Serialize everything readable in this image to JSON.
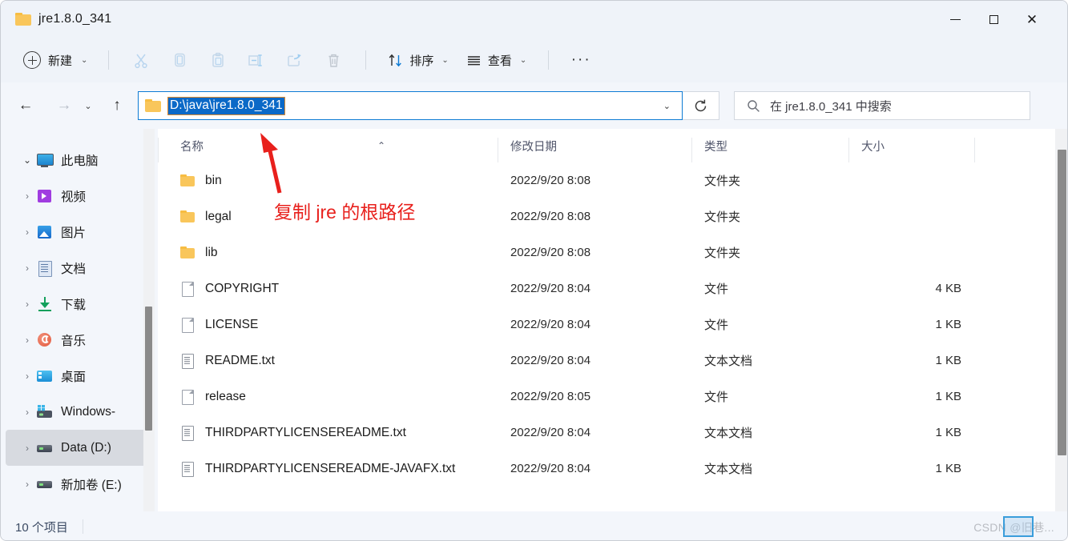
{
  "window": {
    "title": "jre1.8.0_341",
    "folder_icon": "folder-icon",
    "controls": {
      "minimize": "minimize-icon",
      "maximize": "maximize-icon",
      "close": "close-icon"
    }
  },
  "command_bar": {
    "new_label": "新建",
    "new_chevron": "⌄",
    "icons": [
      {
        "name": "cut-icon",
        "label": "剪切"
      },
      {
        "name": "copy-icon",
        "label": "复制"
      },
      {
        "name": "paste-icon",
        "label": "粘贴"
      },
      {
        "name": "rename-icon",
        "label": "重命名"
      },
      {
        "name": "share-icon",
        "label": "共享"
      },
      {
        "name": "delete-icon",
        "label": "删除"
      }
    ],
    "sort_label": "排序",
    "view_label": "查看",
    "overflow_label": "···"
  },
  "navigation": {
    "back": "←",
    "forward": "→",
    "recent_chevron": "⌄",
    "up": "↑",
    "address_path": "D:\\java\\jre1.8.0_341",
    "address_chevron": "⌄",
    "refresh_icon": "refresh-icon"
  },
  "search": {
    "icon": "search-icon",
    "placeholder": "在 jre1.8.0_341 中搜索"
  },
  "sidebar": {
    "items": [
      {
        "label": "此电脑",
        "icon": "this-pc-icon",
        "twisty": "⌄",
        "expanded": true,
        "selected": false
      },
      {
        "label": "视频",
        "icon": "videos-icon",
        "twisty": "›",
        "expanded": false,
        "selected": false
      },
      {
        "label": "图片",
        "icon": "pictures-icon",
        "twisty": "›",
        "expanded": false,
        "selected": false
      },
      {
        "label": "文档",
        "icon": "documents-icon",
        "twisty": "›",
        "expanded": false,
        "selected": false
      },
      {
        "label": "下载",
        "icon": "downloads-icon",
        "twisty": "›",
        "expanded": false,
        "selected": false
      },
      {
        "label": "音乐",
        "icon": "music-icon",
        "twisty": "›",
        "expanded": false,
        "selected": false
      },
      {
        "label": "桌面",
        "icon": "desktop-icon",
        "twisty": "›",
        "expanded": false,
        "selected": false
      },
      {
        "label": "Windows-",
        "icon": "windows-drive-icon",
        "twisty": "›",
        "expanded": false,
        "selected": false
      },
      {
        "label": "Data (D:)",
        "icon": "drive-icon",
        "twisty": "›",
        "expanded": false,
        "selected": true
      },
      {
        "label": "新加卷 (E:)",
        "icon": "drive-icon",
        "twisty": "›",
        "expanded": false,
        "selected": false
      }
    ]
  },
  "file_list": {
    "columns": [
      "名称",
      "修改日期",
      "类型",
      "大小"
    ],
    "sort_indicator": "⌃",
    "rows": [
      {
        "name": "bin",
        "icon": "folder-icon",
        "modified": "2022/9/20 8:08",
        "type": "文件夹",
        "size": ""
      },
      {
        "name": "legal",
        "icon": "folder-icon",
        "modified": "2022/9/20 8:08",
        "type": "文件夹",
        "size": ""
      },
      {
        "name": "lib",
        "icon": "folder-icon",
        "modified": "2022/9/20 8:08",
        "type": "文件夹",
        "size": ""
      },
      {
        "name": "COPYRIGHT",
        "icon": "file-icon",
        "modified": "2022/9/20 8:04",
        "type": "文件",
        "size": "4 KB"
      },
      {
        "name": "LICENSE",
        "icon": "file-icon",
        "modified": "2022/9/20 8:04",
        "type": "文件",
        "size": "1 KB"
      },
      {
        "name": "README.txt",
        "icon": "text-file-icon",
        "modified": "2022/9/20 8:04",
        "type": "文本文档",
        "size": "1 KB"
      },
      {
        "name": "release",
        "icon": "file-icon",
        "modified": "2022/9/20 8:05",
        "type": "文件",
        "size": "1 KB"
      },
      {
        "name": "THIRDPARTYLICENSEREADME.txt",
        "icon": "text-file-icon",
        "modified": "2022/9/20 8:04",
        "type": "文本文档",
        "size": "1 KB"
      },
      {
        "name": "THIRDPARTYLICENSEREADME-JAVAFX.txt",
        "icon": "text-file-icon",
        "modified": "2022/9/20 8:04",
        "type": "文本文档",
        "size": "1 KB"
      }
    ]
  },
  "status_bar": {
    "item_count": "10 个项目"
  },
  "watermark": {
    "text": "CSDN @旧巷..."
  },
  "annotation": {
    "text": "复制 jre 的根路径",
    "color": "#e8201c",
    "arrow": "arrow-up-left"
  },
  "colors": {
    "accent": "#0b69c7",
    "address_border": "#0d7bd4",
    "selection_outline": "#e08a2e",
    "titlebar_bg": "#eff3f9",
    "content_bg": "#ffffff",
    "annotation_red": "#e8201c",
    "folder_yellow": "#f9c65b"
  }
}
